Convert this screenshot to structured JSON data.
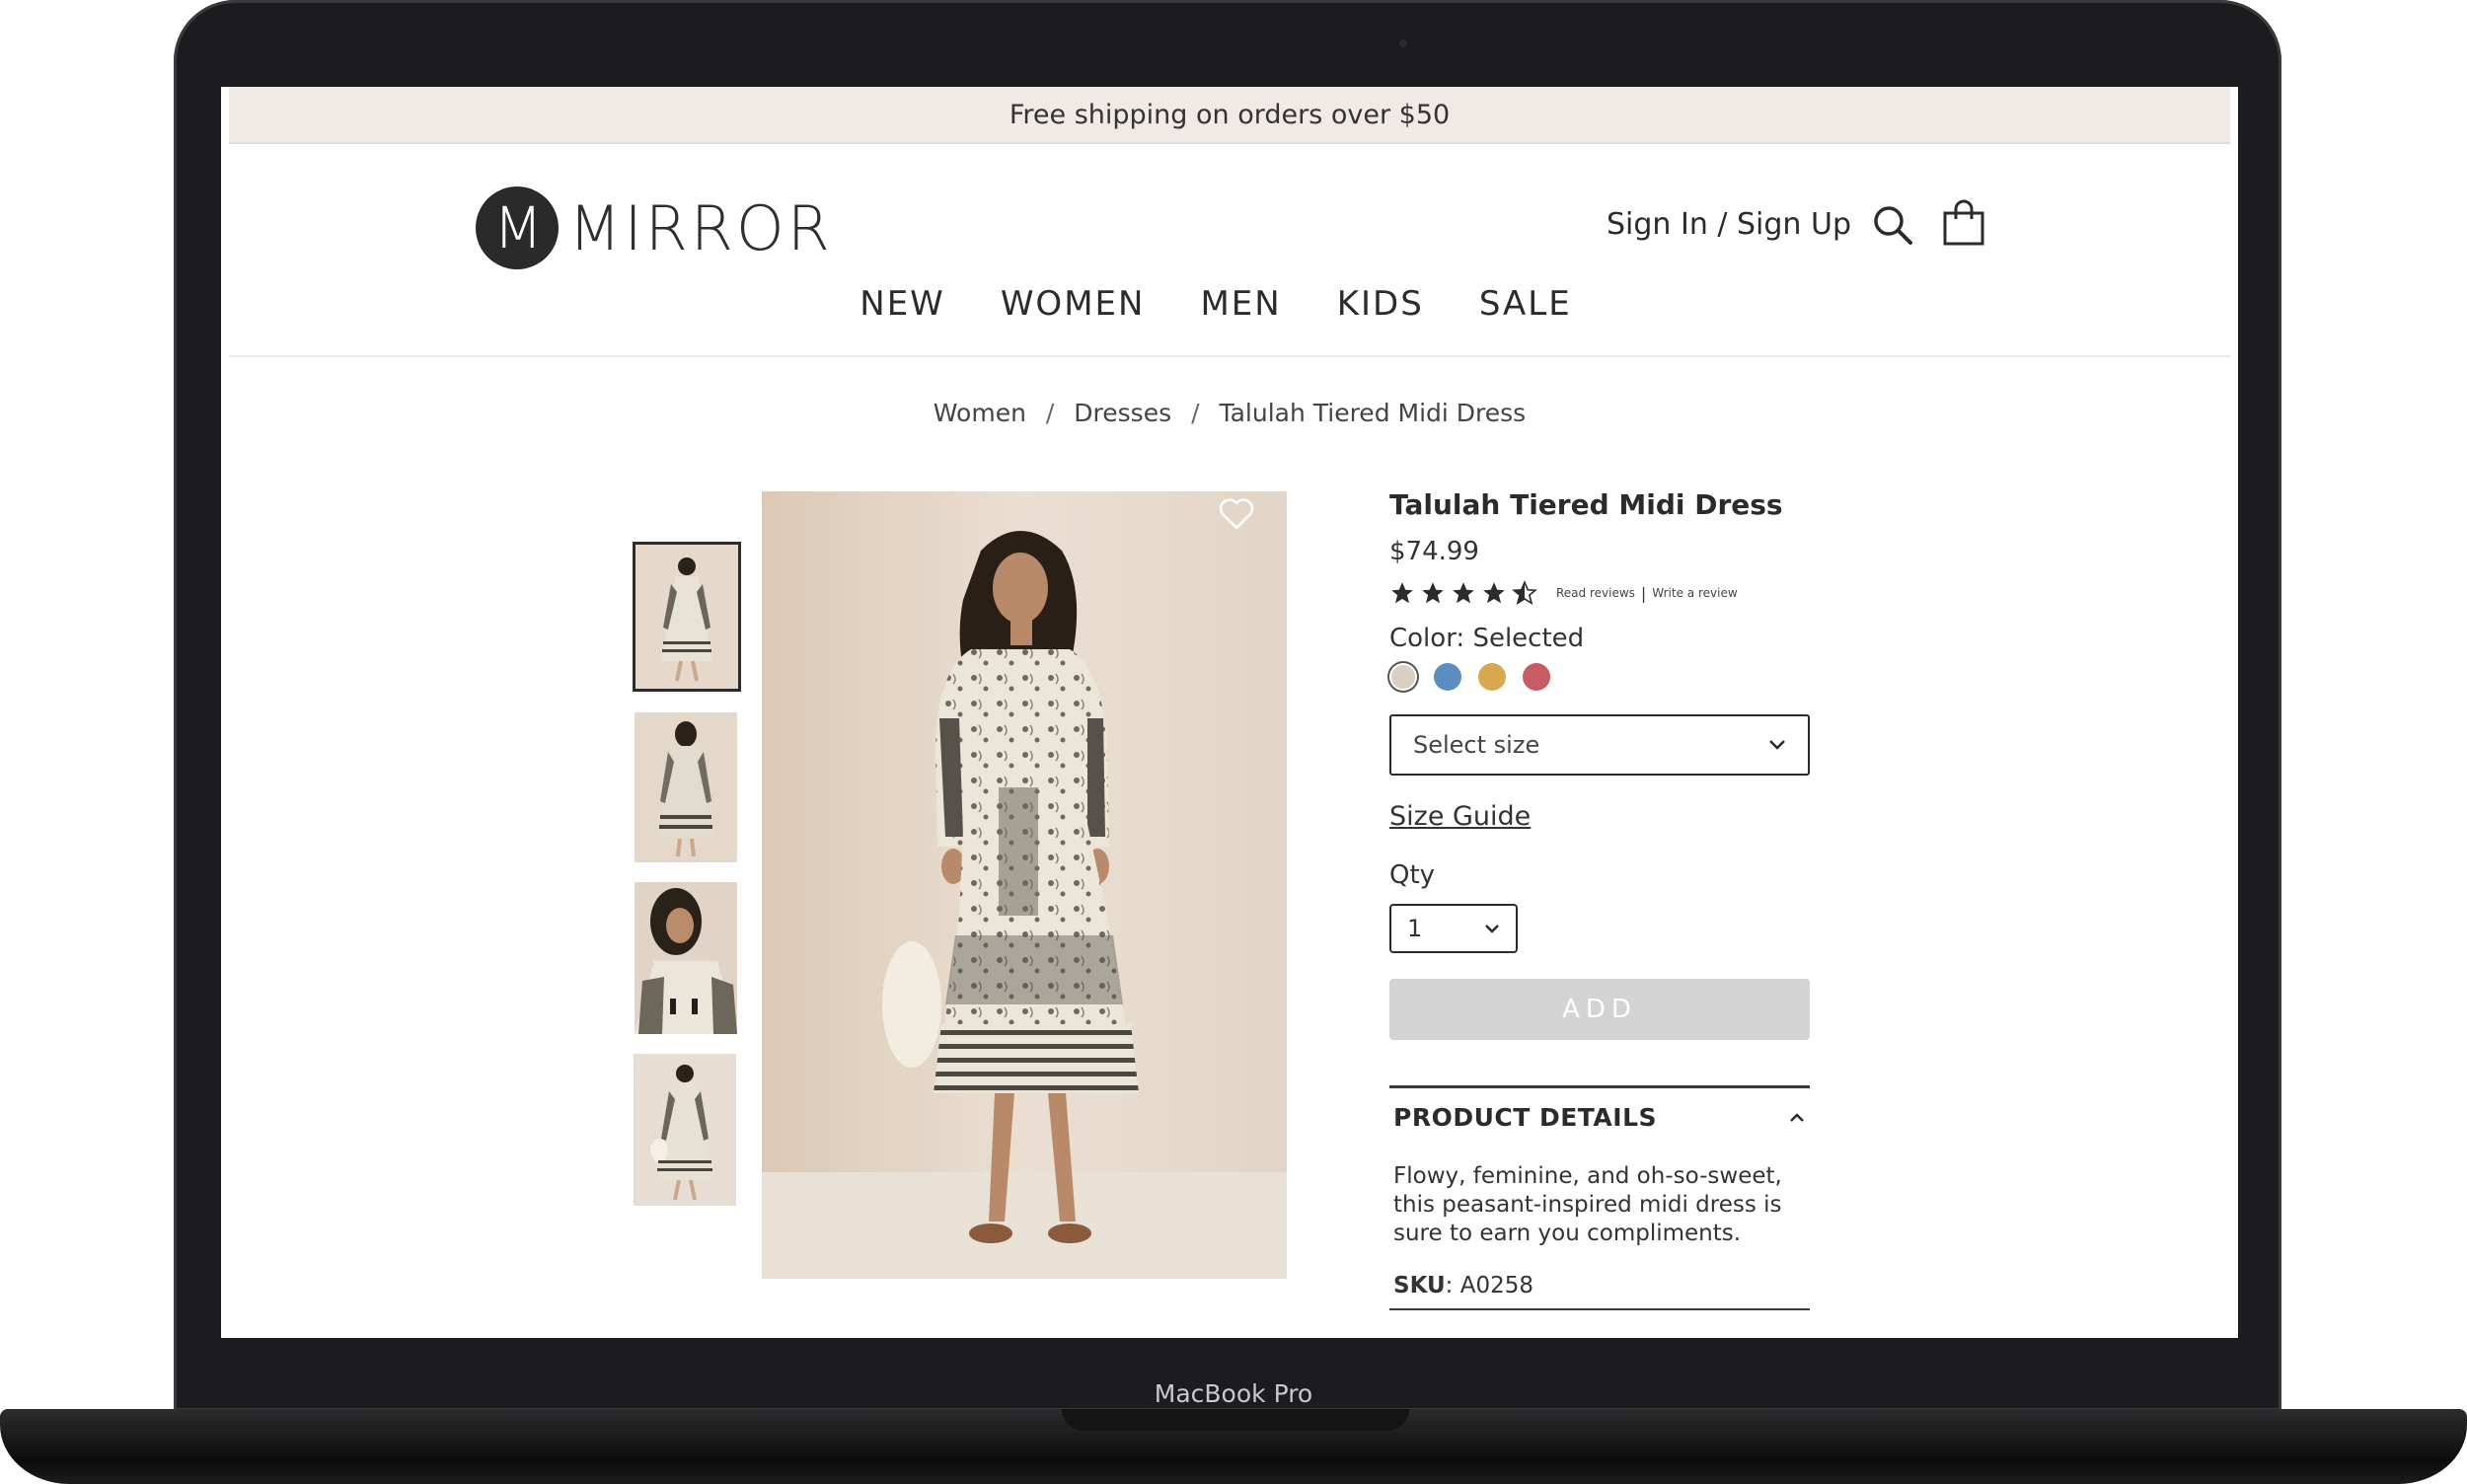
{
  "device": {
    "label": "MacBook Pro"
  },
  "promo": {
    "text": "Free shipping on orders over $50"
  },
  "header": {
    "logo_letter": "M",
    "logo_text": "MIRROR",
    "signin_label": "Sign In / Sign Up",
    "search_icon": "search-icon",
    "cart_icon": "shopping-bag-icon"
  },
  "nav": {
    "items": [
      {
        "label": "NEW"
      },
      {
        "label": "WOMEN"
      },
      {
        "label": "MEN"
      },
      {
        "label": "KIDS"
      },
      {
        "label": "SALE"
      }
    ]
  },
  "breadcrumb": {
    "items": [
      {
        "label": "Women"
      },
      {
        "label": "Dresses"
      },
      {
        "label": "Talulah Tiered Midi Dress"
      }
    ],
    "separator": "/"
  },
  "gallery": {
    "thumbnails": [
      {
        "alt": "front view",
        "active": true
      },
      {
        "alt": "back view",
        "active": false
      },
      {
        "alt": "detail view",
        "active": false
      },
      {
        "alt": "full view",
        "active": false
      }
    ],
    "favorite_icon": "heart-icon"
  },
  "product": {
    "title": "Talulah Tiered Midi Dress",
    "price": "$74.99",
    "rating": 4.5,
    "rating_max": 5,
    "read_reviews": "Read reviews",
    "write_review": "Write a review",
    "color_label": "Color: Selected",
    "colors": [
      {
        "name": "beige",
        "hex": "#d9cfc4",
        "selected": true
      },
      {
        "name": "blue",
        "hex": "#5b8dc1"
      },
      {
        "name": "mustard",
        "hex": "#d7a94f"
      },
      {
        "name": "rose",
        "hex": "#c75a62"
      }
    ],
    "size_placeholder": "Select size",
    "size_guide": "Size Guide",
    "qty_label": "Qty",
    "qty_value": "1",
    "add_label": "ADD",
    "details_title": "PRODUCT DETAILS",
    "details_text": "Flowy, feminine, and oh-so-sweet, this peasant-inspired midi dress is sure to earn you compliments.",
    "sku_label": "SKU",
    "sku_value": ": A0258"
  },
  "colors": {
    "promo_bg": "#f1e9e5",
    "text": "#2b2b2b",
    "add_button_bg": "#d3d3d3",
    "laptop_body": "#1c1c1e"
  }
}
